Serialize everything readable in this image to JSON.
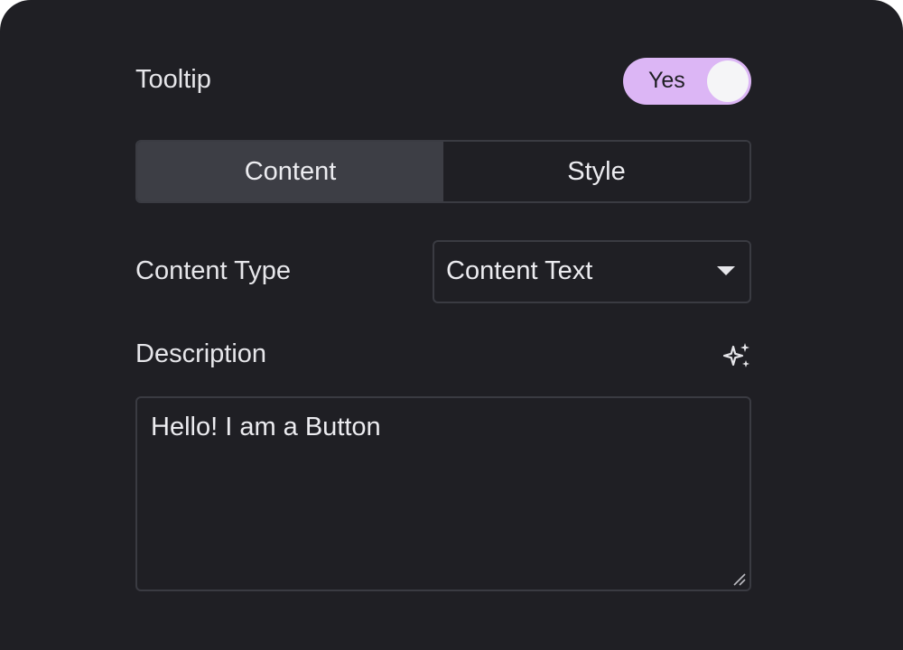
{
  "tooltip": {
    "label": "Tooltip",
    "toggle_text": "Yes",
    "toggle_on": true,
    "toggle_color": "#dcb6f5"
  },
  "tabs": [
    {
      "label": "Content",
      "active": true
    },
    {
      "label": "Style",
      "active": false
    }
  ],
  "content_type": {
    "label": "Content Type",
    "selected": "Content Text"
  },
  "description": {
    "label": "Description",
    "ai_icon": "sparkle-icon",
    "value": "Hello! I am a Button"
  }
}
